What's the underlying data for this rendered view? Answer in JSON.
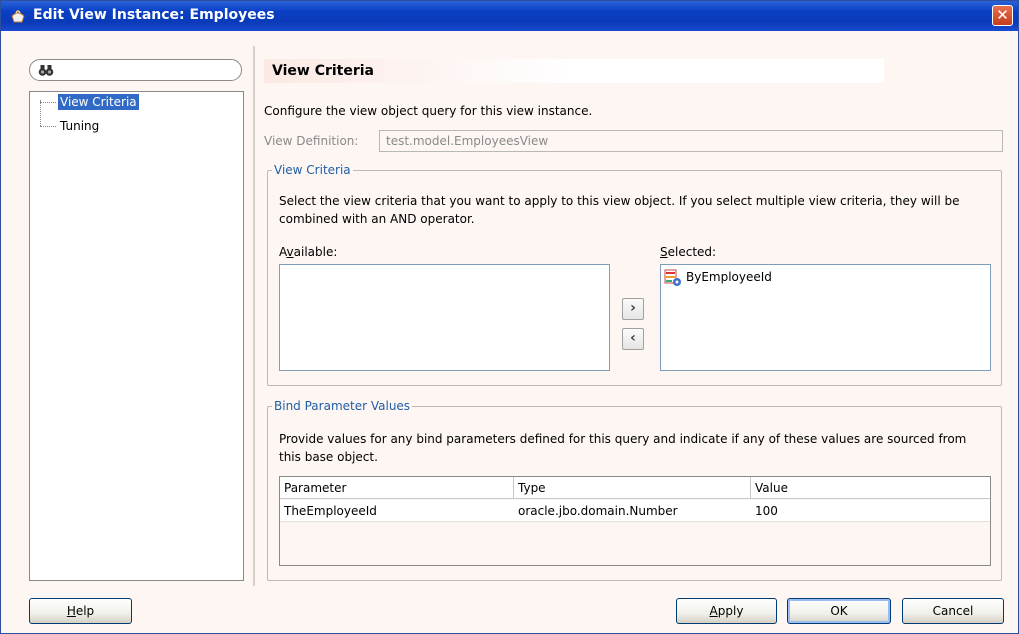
{
  "window": {
    "title": "Edit View Instance: Employees",
    "close_glyph": "✕"
  },
  "search": {
    "icon": "binoculars-icon"
  },
  "nav": {
    "items": [
      {
        "label": "View Criteria",
        "selected": true
      },
      {
        "label": "Tuning",
        "selected": false
      }
    ]
  },
  "page": {
    "title": "View Criteria",
    "description": "Configure the view object query for this view instance.",
    "view_definition_label": "View Definition:",
    "view_definition_value": "test.model.EmployeesView"
  },
  "view_criteria_group": {
    "legend": "View Criteria",
    "instructions_line1": "Select the view criteria that you want to apply to this view object. If you select multiple view criteria, they will be",
    "instructions_line2": "combined with an AND operator.",
    "available_label_pre": "A",
    "available_label_mnemonic": "v",
    "available_label_post": "ailable:",
    "selected_label_mnemonic": "S",
    "selected_label_post": "elected:",
    "available_items": [],
    "selected_items": [
      {
        "label": "ByEmployeeId",
        "icon": "view-criteria-icon"
      }
    ],
    "move_right_glyph": "›",
    "move_left_glyph": "‹"
  },
  "bind_group": {
    "legend": "Bind Parameter Values",
    "instructions_line1": "Provide values for any bind parameters defined for this query and indicate if any of these values are sourced from",
    "instructions_line2": "this base object.",
    "columns": [
      "Parameter",
      "Type",
      "Value"
    ],
    "rows": [
      {
        "parameter": "TheEmployeeId",
        "type": "oracle.jbo.domain.Number",
        "value": "100"
      }
    ]
  },
  "buttons": {
    "help_mnemonic": "H",
    "help_rest": "elp",
    "apply_mnemonic": "A",
    "apply_rest": "pply",
    "ok": "OK",
    "cancel": "Cancel"
  }
}
